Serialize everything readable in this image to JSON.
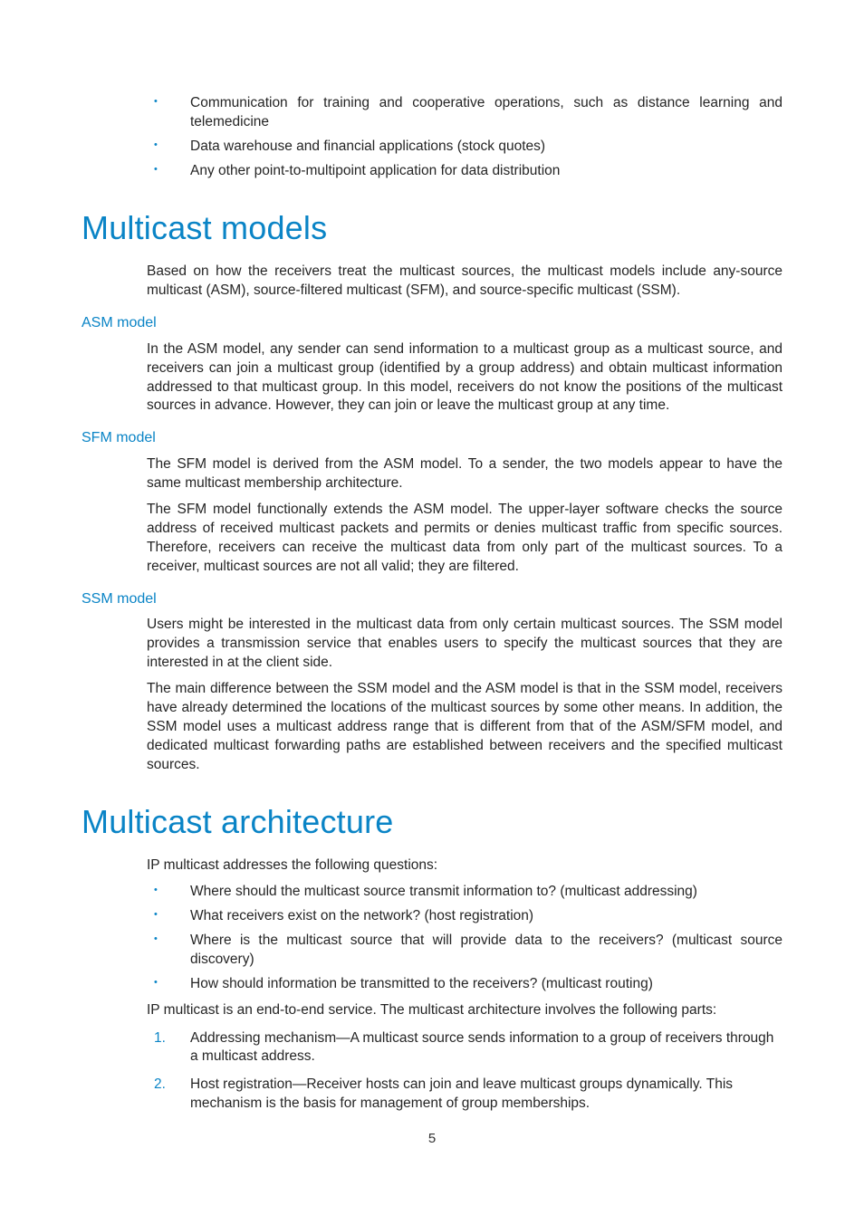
{
  "topBullets": [
    "Communication for training and cooperative operations, such as distance learning and telemedicine",
    "Data warehouse and financial applications (stock quotes)",
    "Any other point-to-multipoint application for data distribution"
  ],
  "section1": {
    "title": "Multicast models",
    "intro": "Based on how the receivers treat the multicast sources, the multicast models include any-source multicast (ASM), source-filtered multicast (SFM), and source-specific multicast (SSM).",
    "asm": {
      "heading": "ASM model",
      "p1": "In the ASM model, any sender can send information to a multicast group as a multicast source, and receivers can join a multicast group (identified by a group address) and obtain multicast information addressed to that multicast group. In this model, receivers do not know the positions of the multicast sources in advance. However, they can join or leave the multicast group at any time."
    },
    "sfm": {
      "heading": "SFM model",
      "p1": "The SFM model is derived from the ASM model. To a sender, the two models appear to have the same multicast membership architecture.",
      "p2": "The SFM model functionally extends the ASM model. The upper-layer software checks the source address of received multicast packets and permits or denies multicast traffic from specific sources. Therefore, receivers can receive the multicast data from only part of the multicast sources. To a receiver, multicast sources are not all valid; they are filtered."
    },
    "ssm": {
      "heading": "SSM model",
      "p1": "Users might be interested in the multicast data from only certain multicast sources. The SSM model provides a transmission service that enables users to specify the multicast sources that they are interested in at the client side.",
      "p2": "The main difference between the SSM model and the ASM model is that in the SSM model, receivers have already determined the locations of the multicast sources by some other means. In addition, the SSM model uses a multicast address range that is different from that of the ASM/SFM model, and dedicated multicast forwarding paths are established between receivers and the specified multicast sources."
    }
  },
  "section2": {
    "title": "Multicast architecture",
    "intro": "IP multicast addresses the following questions:",
    "questions": [
      "Where should the multicast source transmit information to? (multicast addressing)",
      "What receivers exist on the network? (host registration)",
      "Where is the multicast source that will provide data to the receivers? (multicast source discovery)",
      "How should information be transmitted to the receivers? (multicast routing)"
    ],
    "partsIntro": "IP multicast is an end-to-end service. The multicast architecture involves the following parts:",
    "parts": [
      {
        "n": "1.",
        "t": "Addressing mechanism—A multicast source sends information to a group of receivers through a multicast address."
      },
      {
        "n": "2.",
        "t": "Host registration—Receiver hosts can join and leave multicast groups dynamically. This mechanism is the basis for management of group memberships."
      }
    ]
  },
  "pageNumber": "5"
}
